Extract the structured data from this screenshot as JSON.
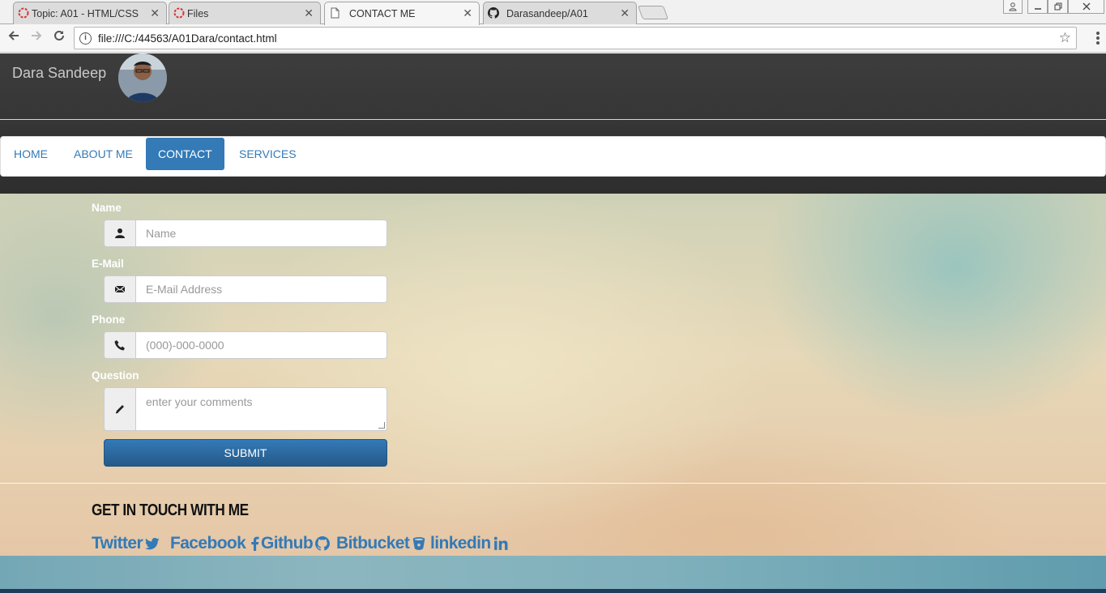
{
  "browser": {
    "tabs": [
      {
        "title": "Topic: A01 - HTML/CSS",
        "icon": "loading-ring-icon"
      },
      {
        "title": "Files",
        "icon": "loading-ring-icon"
      },
      {
        "title": "CONTACT ME",
        "icon": "page-icon",
        "active": true
      },
      {
        "title": "Darasandeep/A01",
        "icon": "github-icon"
      }
    ],
    "close_glyph": "✕",
    "url": "file:///C:/44563/A01Dara/contact.html"
  },
  "site": {
    "brand": "Dara Sandeep",
    "nav": [
      {
        "label": "HOME"
      },
      {
        "label": "ABOUT ME"
      },
      {
        "label": "CONTACT",
        "active": true
      },
      {
        "label": "SERVICES"
      }
    ],
    "active_color": "#337ab7"
  },
  "form": {
    "name_label": "Name",
    "name_placeholder": "Name",
    "email_label": "E-Mail",
    "email_placeholder": "E-Mail Address",
    "phone_label": "Phone",
    "phone_placeholder": "(000)-000-0000",
    "question_label": "Question",
    "question_placeholder": "enter your comments",
    "submit_label": "SUBMIT"
  },
  "contact": {
    "heading": "GET IN TOUCH WITH ME",
    "links": [
      {
        "label": "Twitter",
        "icon": "twitter-icon"
      },
      {
        "label": "Facebook",
        "icon": "facebook-icon"
      },
      {
        "label": "Github",
        "icon": "github-icon"
      },
      {
        "label": "Bitbucket",
        "icon": "bitbucket-icon"
      },
      {
        "label": "linkedin",
        "icon": "linkedin-icon"
      }
    ],
    "link_color": "#337ab7"
  }
}
